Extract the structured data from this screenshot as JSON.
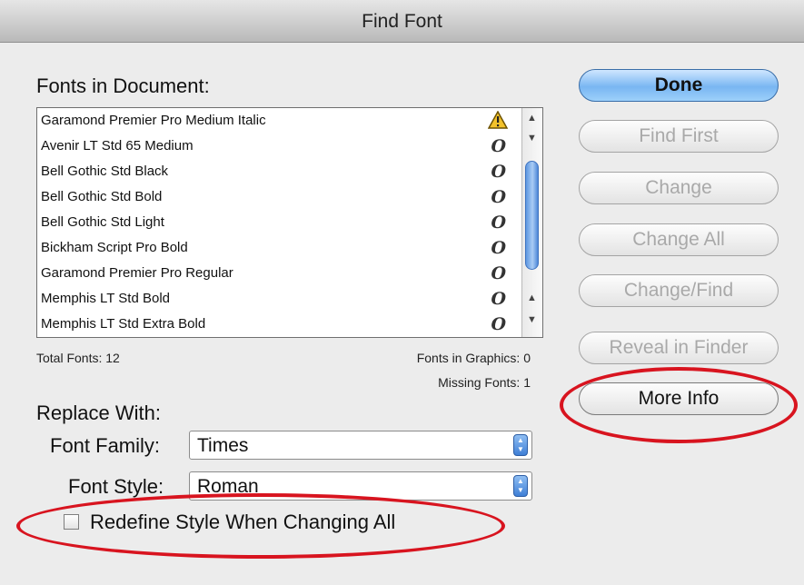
{
  "window": {
    "title": "Find Font"
  },
  "fonts_panel": {
    "heading": "Fonts in Document:",
    "fonts": [
      {
        "name": "Garamond Premier Pro Medium Italic",
        "icon": "warning-icon",
        "status": "missing"
      },
      {
        "name": "Avenir LT Std 65 Medium",
        "icon": "opentype-icon",
        "glyph": "O"
      },
      {
        "name": "Bell Gothic Std Black",
        "icon": "opentype-icon",
        "glyph": "O"
      },
      {
        "name": "Bell Gothic Std Bold",
        "icon": "opentype-icon",
        "glyph": "O"
      },
      {
        "name": "Bell Gothic Std Light",
        "icon": "opentype-icon",
        "glyph": "O"
      },
      {
        "name": "Bickham Script Pro Bold",
        "icon": "opentype-icon",
        "glyph": "O"
      },
      {
        "name": "Garamond Premier Pro Regular",
        "icon": "opentype-icon",
        "glyph": "O"
      },
      {
        "name": "Memphis LT Std Bold",
        "icon": "opentype-icon",
        "glyph": "O"
      },
      {
        "name": "Memphis LT Std Extra Bold",
        "icon": "opentype-icon",
        "glyph": "O"
      }
    ],
    "total_fonts": "Total Fonts: 12",
    "fonts_in_graphics": "Fonts in Graphics: 0",
    "missing_fonts": "Missing Fonts: 1"
  },
  "replace_with": {
    "heading": "Replace With:",
    "font_family_label": "Font Family:",
    "font_family_value": "Times",
    "font_style_label": "Font Style:",
    "font_style_value": "Roman",
    "redefine_label": "Redefine Style When Changing All",
    "redefine_checked": false
  },
  "buttons": {
    "done": "Done",
    "find_first": "Find First",
    "change": "Change",
    "change_all": "Change All",
    "change_find": "Change/Find",
    "reveal_in_finder": "Reveal in Finder",
    "more_info": "More Info"
  },
  "colors": {
    "highlight_ring": "#d8141f",
    "primary_button": "#79b6f2"
  }
}
